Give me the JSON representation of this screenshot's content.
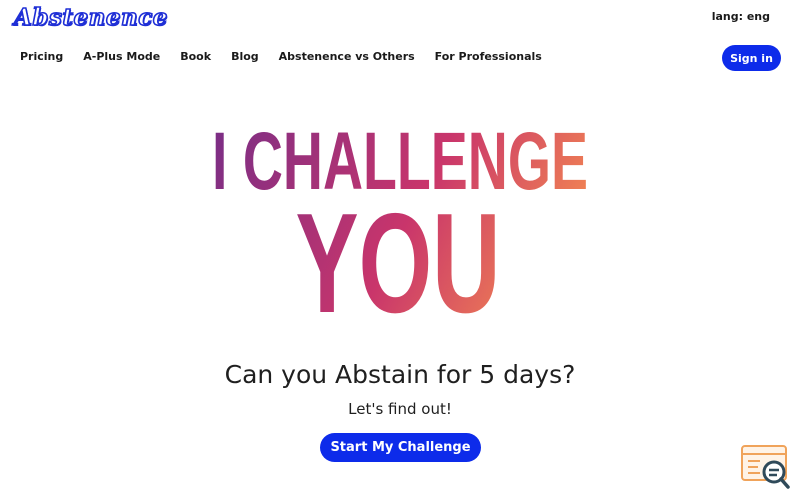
{
  "header": {
    "logo": "Abstenence",
    "lang": "lang: eng"
  },
  "nav": {
    "items": [
      "Pricing",
      "A-Plus Mode",
      "Book",
      "Blog",
      "Abstenence vs Others",
      "For Professionals"
    ],
    "signin_label": "Sign in"
  },
  "hero": {
    "line1": "I CHALLENGE",
    "line2": "YOU",
    "gradient_start": "#7a2e86",
    "gradient_mid": "#c9356b",
    "gradient_end": "#f7904f"
  },
  "main": {
    "headline": "Can you Abstain for 5 days?",
    "subline": "Let's find out!",
    "cta_label": "Start My Challenge"
  },
  "colors": {
    "accent": "#0d2bea"
  },
  "widget": {
    "icon": "search-console-icon"
  }
}
